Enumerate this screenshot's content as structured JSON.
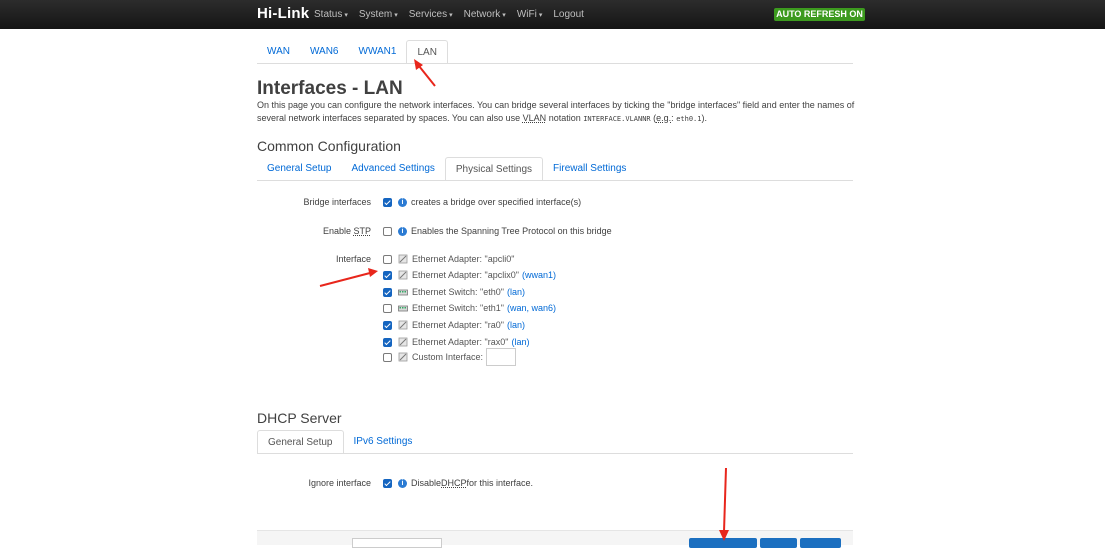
{
  "navbar": {
    "brand": "Hi-Link",
    "menu": [
      {
        "label": "Status",
        "caret": "▾"
      },
      {
        "label": "System",
        "caret": "▾"
      },
      {
        "label": "Services",
        "caret": "▾"
      },
      {
        "label": "Network",
        "caret": "▾"
      },
      {
        "label": "WiFi",
        "caret": "▾"
      },
      {
        "label": "Logout",
        "caret": ""
      }
    ],
    "auto_refresh": "AUTO REFRESH ON",
    "auto_refresh_color": "#3c9a1e"
  },
  "iface_tabs": [
    "WAN",
    "WAN6",
    "WWAN1",
    "LAN"
  ],
  "iface_tabs_active": "LAN",
  "page": {
    "title": "Interfaces - LAN",
    "desc_1": "On this page you can configure the network interfaces. You can bridge several interfaces by ticking the \"bridge interfaces\" field and enter the names of several network interfaces separated by spaces. You can also use ",
    "desc_vlan": "VLAN",
    "desc_2": " notation ",
    "desc_notation": "INTERFACE.VLANNR",
    "desc_3": " (",
    "desc_eg": "e.g.",
    "desc_4": ": ",
    "desc_example": "eth0.1",
    "desc_5": ")."
  },
  "common": {
    "title": "Common Configuration",
    "tabs": [
      "General Setup",
      "Advanced Settings",
      "Physical Settings",
      "Firewall Settings"
    ],
    "active_tab": "Physical Settings",
    "bridge": {
      "label": "Bridge interfaces",
      "checked": true,
      "help": "creates a bridge over specified interface(s)"
    },
    "stp": {
      "label_pre": "Enable ",
      "label_abbr": "STP",
      "checked": false,
      "help": "Enables the Spanning Tree Protocol on this bridge"
    },
    "interface_label": "Interface",
    "interfaces": [
      {
        "checked": false,
        "icon": "ethernet-adapter-icon",
        "text": "Ethernet Adapter: \"apcli0\"",
        "networks": ""
      },
      {
        "checked": true,
        "icon": "ethernet-adapter-icon",
        "text": "Ethernet Adapter: \"apclix0\"",
        "networks": "(wwan1)"
      },
      {
        "checked": true,
        "icon": "ethernet-switch-icon",
        "text": "Ethernet Switch: \"eth0\"",
        "networks": "(lan)"
      },
      {
        "checked": false,
        "icon": "ethernet-switch-icon",
        "text": "Ethernet Switch: \"eth1\"",
        "networks": "(wan, wan6)"
      },
      {
        "checked": true,
        "icon": "ethernet-adapter-icon",
        "text": "Ethernet Adapter: \"ra0\"",
        "networks": "(lan)"
      },
      {
        "checked": true,
        "icon": "ethernet-adapter-icon",
        "text": "Ethernet Adapter: \"rax0\"",
        "networks": "(lan)"
      }
    ],
    "custom": {
      "checked": false,
      "text": "Custom Interface:",
      "value": ""
    }
  },
  "dhcp": {
    "title": "DHCP Server",
    "tabs": [
      "General Setup",
      "IPv6 Settings"
    ],
    "active_tab": "General Setup",
    "ignore": {
      "label": "Ignore interface",
      "checked": true,
      "help_pre": "Disable ",
      "help_abbr": "DHCP",
      "help_post": " for this interface."
    }
  },
  "annotation_color": "#e8261c"
}
